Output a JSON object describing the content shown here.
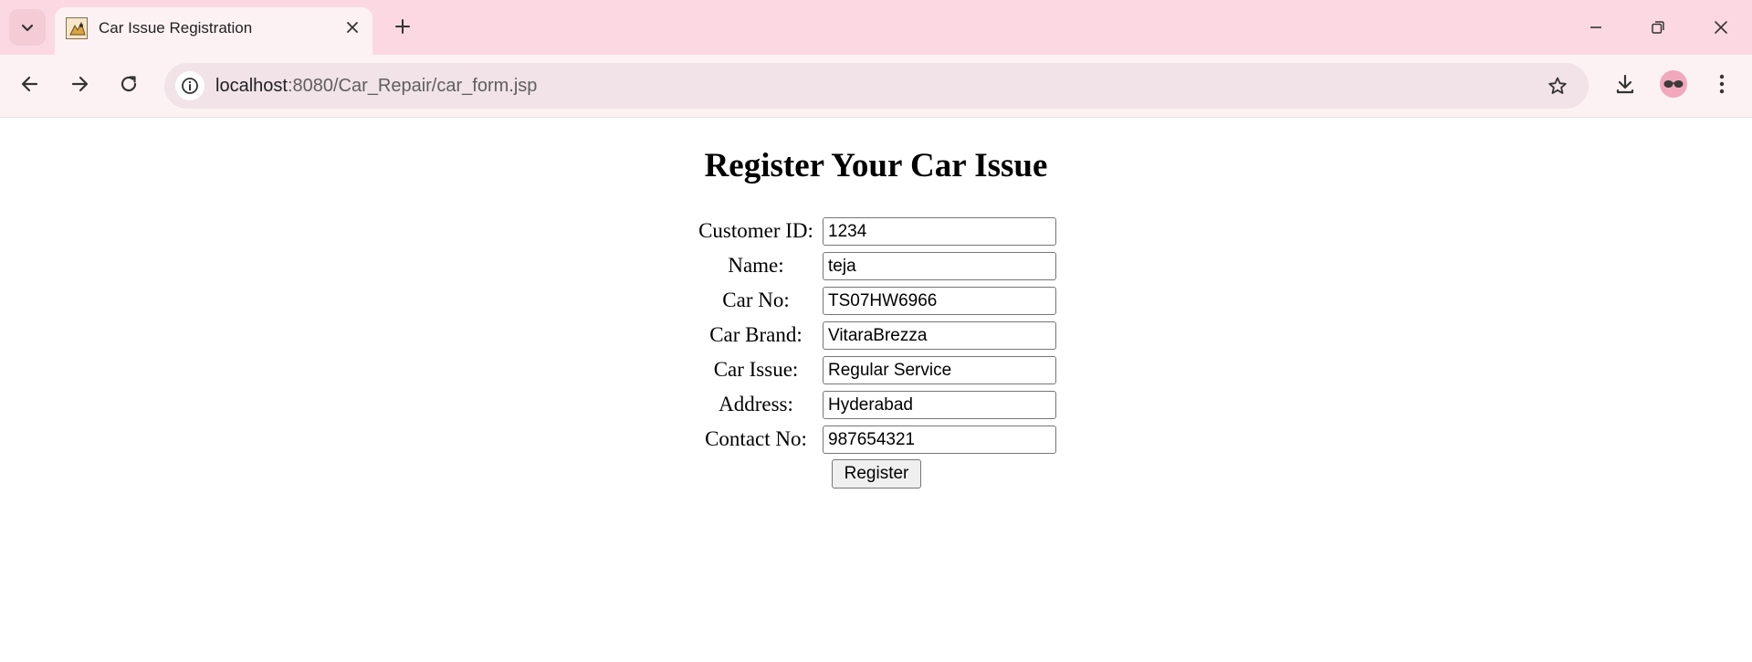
{
  "browser": {
    "tab": {
      "title": "Car Issue Registration"
    },
    "address_bar": {
      "host": "localhost",
      "path": ":8080/Car_Repair/car_form.jsp"
    }
  },
  "page": {
    "title": "Register Your Car Issue",
    "form": {
      "fields": [
        {
          "label": "Customer ID:",
          "value": "1234"
        },
        {
          "label": "Name:",
          "value": "teja"
        },
        {
          "label": "Car No:",
          "value": "TS07HW6966"
        },
        {
          "label": "Car Brand:",
          "value": "VitaraBrezza"
        },
        {
          "label": "Car Issue:",
          "value": "Regular Service"
        },
        {
          "label": "Address:",
          "value": "Hyderabad"
        },
        {
          "label": "Contact No:",
          "value": "987654321"
        }
      ],
      "submit_label": "Register"
    }
  },
  "icons": {
    "tab_list": "chevron-down-icon",
    "favicon": "tomcat-favicon-icon",
    "tab_close": "close-icon",
    "new_tab": "plus-icon",
    "minimize": "minimize-icon",
    "restore": "restore-icon",
    "close_window": "close-icon",
    "back": "arrow-left-icon",
    "forward": "arrow-right-icon",
    "reload": "reload-icon",
    "site_info": "info-icon",
    "bookmark": "star-icon",
    "downloads": "download-icon",
    "profile": "avatar-glasses-icon",
    "menu": "kebab-menu-icon"
  },
  "colors": {
    "tabbar_bg": "#fcd9e2",
    "toolbar_bg": "#fcf2f4",
    "omnibox_bg": "#f1e3e8",
    "avatar_bg": "#f2a9bd"
  }
}
